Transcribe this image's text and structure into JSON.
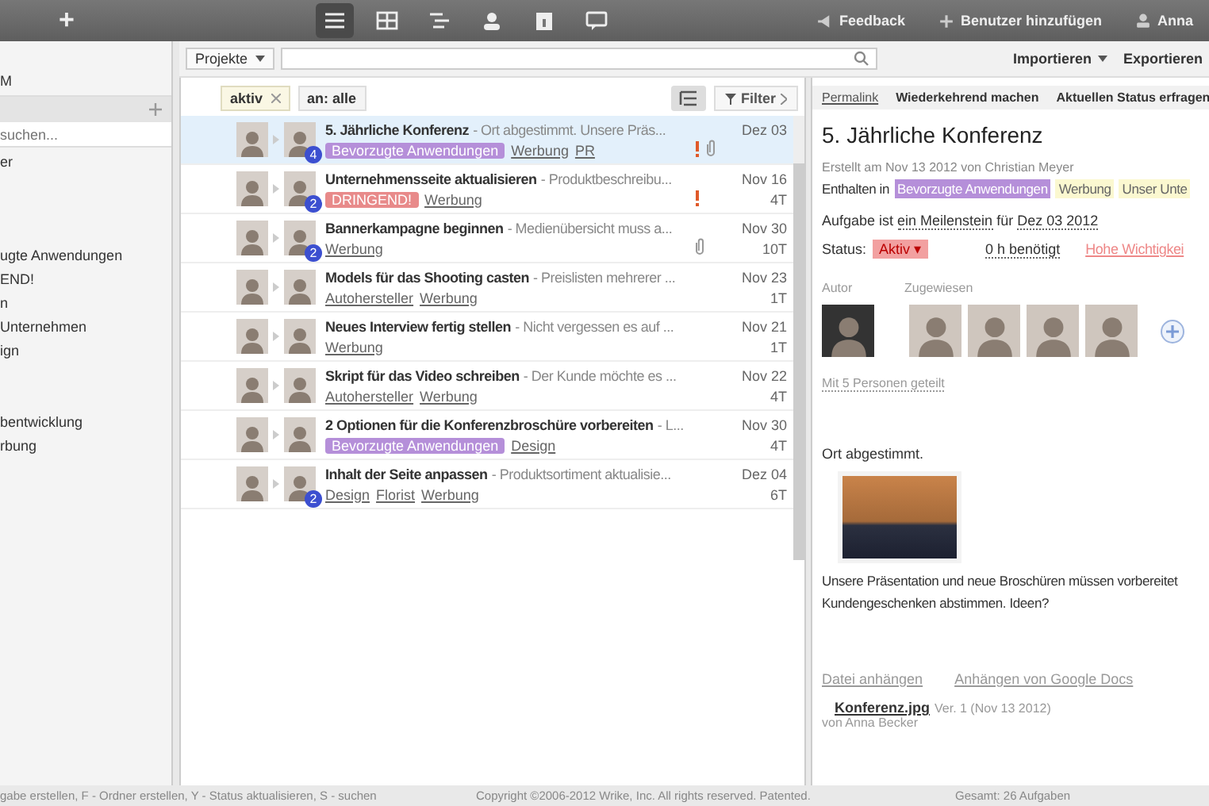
{
  "topbar": {
    "add_label": "+",
    "views": [
      {
        "kind": "list",
        "selected": true
      },
      {
        "kind": "table",
        "selected": false
      },
      {
        "kind": "gantt",
        "selected": false
      },
      {
        "kind": "person",
        "selected": false
      },
      {
        "kind": "report",
        "selected": false
      },
      {
        "kind": "stream",
        "selected": false
      }
    ],
    "actions": [
      {
        "kind": "feedback",
        "label": "Feedback"
      },
      {
        "kind": "add-user",
        "label": "Benutzer hinzufügen"
      },
      {
        "kind": "user",
        "label": "Anna"
      }
    ]
  },
  "sidebar": {
    "top_item": "M",
    "search": {
      "placeholder": "suchen..."
    },
    "groups": [
      [
        "er"
      ],
      [
        "ugte Anwendungen",
        "END!",
        "n",
        "Unternehmen",
        "ign"
      ],
      [
        "bentwicklung",
        "rbung"
      ]
    ]
  },
  "toolbar": {
    "scope": "Projekte",
    "actions": [
      "Importieren",
      "Exportieren"
    ]
  },
  "filters": {
    "chips": [
      {
        "label": "aktiv",
        "removable": true
      },
      {
        "label": "an: alle",
        "removable": false
      }
    ],
    "filter_button": "Filter"
  },
  "tasks": [
    {
      "title": "5. Jährliche Konferenz",
      "desc": "- Ort abgestimmt. Unsere Präs...",
      "tags": [
        {
          "kind": "label",
          "text": "Bevorzugte Anwendungen",
          "color": "#b58fd9"
        },
        {
          "kind": "link",
          "text": "Werbung"
        },
        {
          "kind": "link",
          "text": "PR"
        }
      ],
      "important": true,
      "attachment": true,
      "date": "Dez 03",
      "badge": "4",
      "selected": true
    },
    {
      "title": "Unternehmensseite aktualisieren",
      "desc": "- Produktbeschreibu...",
      "tags": [
        {
          "kind": "label",
          "text": "DRINGEND!",
          "color": "#e88a8a"
        },
        {
          "kind": "link",
          "text": "Werbung"
        }
      ],
      "important": true,
      "attachment": false,
      "date": "Nov 16",
      "duration": "4T",
      "badge": "2",
      "selected": false
    },
    {
      "title": "Bannerkampagne beginnen",
      "desc": "- Medienübersicht muss a...",
      "tags": [
        {
          "kind": "link",
          "text": "Werbung"
        }
      ],
      "important": false,
      "attachment": true,
      "date": "Nov 30",
      "duration": "10T",
      "badge": "2",
      "selected": false
    },
    {
      "title": "Models für das Shooting casten",
      "desc": "- Preislisten mehrerer ...",
      "tags": [
        {
          "kind": "link",
          "text": "Autohersteller"
        },
        {
          "kind": "link",
          "text": "Werbung"
        }
      ],
      "important": false,
      "attachment": false,
      "date": "Nov 23",
      "duration": "1T",
      "selected": false
    },
    {
      "title": "Neues Interview fertig stellen",
      "desc": "- Nicht vergessen es auf ...",
      "tags": [
        {
          "kind": "link",
          "text": "Werbung"
        }
      ],
      "important": false,
      "attachment": false,
      "date": "Nov 21",
      "duration": "1T",
      "selected": false
    },
    {
      "title": "Skript für das Video schreiben",
      "desc": "- Der Kunde möchte es ...",
      "tags": [
        {
          "kind": "link",
          "text": "Autohersteller"
        },
        {
          "kind": "link",
          "text": "Werbung"
        }
      ],
      "important": false,
      "attachment": false,
      "date": "Nov 22",
      "duration": "4T",
      "selected": false
    },
    {
      "title": "2 Optionen für die Konferenzbroschüre vorbereiten",
      "desc": "- L...",
      "tags": [
        {
          "kind": "label",
          "text": "Bevorzugte Anwendungen",
          "color": "#b58fd9"
        },
        {
          "kind": "link",
          "text": "Design"
        }
      ],
      "important": false,
      "attachment": false,
      "date": "Nov 30",
      "duration": "4T",
      "selected": false
    },
    {
      "title": "Inhalt der Seite anpassen",
      "desc": "- Produktsortiment aktualisie...",
      "tags": [
        {
          "kind": "link",
          "text": "Design"
        },
        {
          "kind": "link",
          "text": "Florist"
        },
        {
          "kind": "link",
          "text": "Werbung"
        }
      ],
      "important": false,
      "attachment": false,
      "date": "Dez 04",
      "duration": "6T",
      "badge": "2",
      "selected": false
    }
  ],
  "detail": {
    "actions": [
      {
        "kind": "link",
        "label": "Permalink"
      },
      {
        "kind": "button",
        "label": "Wiederkehrend machen"
      },
      {
        "kind": "button",
        "label": "Aktuellen Status erfragen"
      }
    ],
    "title": "5. Jährliche Konferenz",
    "created": "Erstellt am Nov 13 2012 von Christian Meyer",
    "contained_label": "Enthalten in",
    "folders": [
      {
        "text": "Bevorzugte Anwendungen",
        "color": "#b58fd9"
      },
      {
        "text": "Werbung",
        "color": "#fbf8d0"
      },
      {
        "text": "Unser Unte",
        "color": "#fbf8d0"
      }
    ],
    "milestone": [
      "Aufgabe ist ",
      "ein Meilenstein",
      " für ",
      "Dez 03 2012"
    ],
    "status_label": "Status:",
    "status": "Aktiv ▾",
    "effort": "0 h benötigt",
    "importance": "Hohe Wichtigkei",
    "author_label": "Autor",
    "assignees_label": "Zugewiesen",
    "shared": "Mit 5 Personen geteilt",
    "comment_title": "Ort abgestimmt.",
    "body": [
      "Unsere Präsentation und neue Broschüren müssen vorbereitet",
      "Kundengeschenken abstimmen. Ideen?"
    ],
    "attach_links": [
      "Datei anhängen",
      "Anhängen von Google Docs"
    ],
    "file": {
      "name": "Konferenz.jpg",
      "version": "Ver. 1 (Nov 13 2012)",
      "by": "von Anna Becker"
    }
  },
  "status_bar": {
    "shortcuts": "gabe erstellen, F - Ordner erstellen, Y - Status aktualisieren, S - suchen",
    "copyright": "Copyright ©2006-2012 Wrike, Inc. All rights reserved. Patented.",
    "total": "Gesamt: 26 Aufgaben"
  }
}
